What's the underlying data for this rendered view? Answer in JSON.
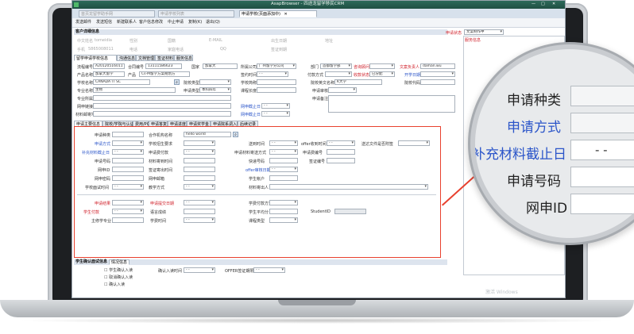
{
  "window": {
    "title": "AsapBrowser - 四途龙留学移民CRM"
  },
  "tabs": [
    {
      "label": "首页龙留学助手网"
    },
    {
      "label": "申请学校列表"
    },
    {
      "label": "申请学校(页面添加中)"
    }
  ],
  "toolbar": [
    "发送邮件",
    "发送短信",
    "新建联系人",
    "客户信息修改",
    "中止申请",
    "复制(K)",
    "退出(Q)"
  ],
  "section_basic": "客户详细信息",
  "basic": {
    "cn_name_label": "中文姓名",
    "cn_name": "tomeidia",
    "mobile_label": "手机",
    "mobile": "5865008011",
    "nat_label": "国籍",
    "email_label": "E-MAIL",
    "birth_label": "出生日期",
    "addr_label": "地址",
    "gender_label": "性别",
    "qq_label": "QQ",
    "phone_label": "电话",
    "home_label": "家庭电话",
    "visa_label": "签证到期"
  },
  "status": {
    "label": "申请状态",
    "value": "文案制作中",
    "side_title": "服务信息"
  },
  "inner_tabs": [
    "留学申请学校信息",
    "沟通信息",
    "文档管理",
    "签证材料",
    "服务信息"
  ],
  "apply": {
    "serial_label": "流程编号",
    "serial": "A20120516011",
    "contract_label": "合同编号",
    "contract": "13111586623",
    "country_label": "国家",
    "country": "加拿大",
    "company_label": "所属公司",
    "company": "广州留学分公司",
    "dept_label": "部门",
    "dept": "首都留学部",
    "consult_label": "咨询顾问",
    "consult": "",
    "doc_label": "文案负责人",
    "doc": "daman.wu",
    "product_label": "产品名称",
    "product": "加拿大留学",
    "product2_label": "产品",
    "product2": "Cs-M留学方案规划方",
    "sign_label": "签约时间",
    "pay_label": "付款方式",
    "fund_label": "收款状态",
    "fund": "已分配",
    "open_label": "开学日期",
    "school_label": "学校名称",
    "school": "CANADA IT SC",
    "school_type_label": "院校类型",
    "school_dept_label": "学校简称",
    "school_en_label": "院校英文名称",
    "school_en": "K大学",
    "school_code_label": "院校代码",
    "major_label": "专业名称",
    "major": "生物",
    "apply_type_label": "申请类型",
    "apply_type": "本科四年",
    "course_label": "课程长度",
    "approve_label": "申请审核",
    "major_en_label": "专业所属",
    "remark_label": "申请备注",
    "web_label": "网申链接",
    "deadline_label": "网申截止日",
    "material_label": "材料邮寄地址",
    "deadline2_label": "网申截止日"
  },
  "sub_tabs": [
    "申请主要信息",
    "院校/学院与认证",
    "费用/PG",
    "申请答复",
    "申请进度",
    "申请奖学金",
    "申请院系调入学",
    "后续记录"
  ],
  "detail": {
    "kind_label": "申请种类",
    "method_label": "申请方式",
    "supp_label": "补充材料截止日",
    "no_label": "申请号码",
    "wang_label": "网申ID",
    "pwd_label": "网申密码",
    "mail_label": "网申邮箱",
    "method2_label": "学校面试时间",
    "agency_label": "合作机构名称",
    "agency": "hello world",
    "std_label": "学校招生要求",
    "fee_label": "申请费付款",
    "send_label": "送到时间",
    "deliver_label": "申请材料寄送方式",
    "time1_label": "材料寄到时间",
    "time2_label": "签证寄出时间",
    "num_label": "申请费编号",
    "exp_label": "快递号码",
    "visa_no_label": "签证编号",
    "offer_time_label": "offer收到时间",
    "offer_check_label": "offer审核日期",
    "offer_type_label": "送达文件是否附签",
    "teach_label": "教学方式",
    "acct_label": "学生帐户",
    "status_label": "申请结果",
    "app_date_label": "申请提交日期",
    "paid_label": "学生付款",
    "reason_label": "材料寄出人",
    "ielts_label": "语言成绩",
    "score_label": "学生平均分",
    "student_id_label": "StudentID",
    "major_type_label": "录取专业",
    "plan_label": "学费时间",
    "prop_label": "课程类型",
    "pay_way_label": "学费付款方式",
    "stay_label": "主修学专业"
  },
  "bottom": {
    "section": "学生确认面试信息",
    "tab": "情况信息",
    "check1": "学生确认入读",
    "check2": "取消确认入读",
    "check3": "确认入读",
    "time_label": "确认入读时间",
    "offer_label": "OFFER签证期限"
  },
  "watermark": "激活 Windows",
  "magnifier": {
    "labels": [
      "申请种类",
      "申请方式",
      "补充材料截止日",
      "申请号码",
      "网申ID"
    ],
    "dash": "- -"
  }
}
